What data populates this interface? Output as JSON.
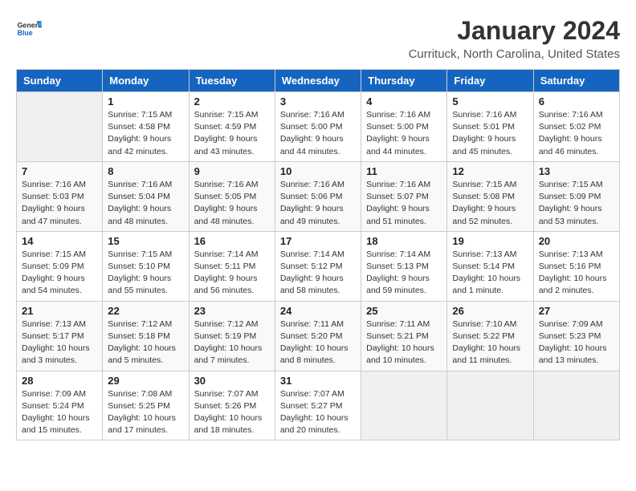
{
  "header": {
    "logo_general": "General",
    "logo_blue": "Blue",
    "main_title": "January 2024",
    "subtitle": "Currituck, North Carolina, United States"
  },
  "days_of_week": [
    "Sunday",
    "Monday",
    "Tuesday",
    "Wednesday",
    "Thursday",
    "Friday",
    "Saturday"
  ],
  "weeks": [
    [
      {
        "day": "",
        "info": ""
      },
      {
        "day": "1",
        "info": "Sunrise: 7:15 AM\nSunset: 4:58 PM\nDaylight: 9 hours\nand 42 minutes."
      },
      {
        "day": "2",
        "info": "Sunrise: 7:15 AM\nSunset: 4:59 PM\nDaylight: 9 hours\nand 43 minutes."
      },
      {
        "day": "3",
        "info": "Sunrise: 7:16 AM\nSunset: 5:00 PM\nDaylight: 9 hours\nand 44 minutes."
      },
      {
        "day": "4",
        "info": "Sunrise: 7:16 AM\nSunset: 5:00 PM\nDaylight: 9 hours\nand 44 minutes."
      },
      {
        "day": "5",
        "info": "Sunrise: 7:16 AM\nSunset: 5:01 PM\nDaylight: 9 hours\nand 45 minutes."
      },
      {
        "day": "6",
        "info": "Sunrise: 7:16 AM\nSunset: 5:02 PM\nDaylight: 9 hours\nand 46 minutes."
      }
    ],
    [
      {
        "day": "7",
        "info": "Sunrise: 7:16 AM\nSunset: 5:03 PM\nDaylight: 9 hours\nand 47 minutes."
      },
      {
        "day": "8",
        "info": "Sunrise: 7:16 AM\nSunset: 5:04 PM\nDaylight: 9 hours\nand 48 minutes."
      },
      {
        "day": "9",
        "info": "Sunrise: 7:16 AM\nSunset: 5:05 PM\nDaylight: 9 hours\nand 48 minutes."
      },
      {
        "day": "10",
        "info": "Sunrise: 7:16 AM\nSunset: 5:06 PM\nDaylight: 9 hours\nand 49 minutes."
      },
      {
        "day": "11",
        "info": "Sunrise: 7:16 AM\nSunset: 5:07 PM\nDaylight: 9 hours\nand 51 minutes."
      },
      {
        "day": "12",
        "info": "Sunrise: 7:15 AM\nSunset: 5:08 PM\nDaylight: 9 hours\nand 52 minutes."
      },
      {
        "day": "13",
        "info": "Sunrise: 7:15 AM\nSunset: 5:09 PM\nDaylight: 9 hours\nand 53 minutes."
      }
    ],
    [
      {
        "day": "14",
        "info": "Sunrise: 7:15 AM\nSunset: 5:09 PM\nDaylight: 9 hours\nand 54 minutes."
      },
      {
        "day": "15",
        "info": "Sunrise: 7:15 AM\nSunset: 5:10 PM\nDaylight: 9 hours\nand 55 minutes."
      },
      {
        "day": "16",
        "info": "Sunrise: 7:14 AM\nSunset: 5:11 PM\nDaylight: 9 hours\nand 56 minutes."
      },
      {
        "day": "17",
        "info": "Sunrise: 7:14 AM\nSunset: 5:12 PM\nDaylight: 9 hours\nand 58 minutes."
      },
      {
        "day": "18",
        "info": "Sunrise: 7:14 AM\nSunset: 5:13 PM\nDaylight: 9 hours\nand 59 minutes."
      },
      {
        "day": "19",
        "info": "Sunrise: 7:13 AM\nSunset: 5:14 PM\nDaylight: 10 hours\nand 1 minute."
      },
      {
        "day": "20",
        "info": "Sunrise: 7:13 AM\nSunset: 5:16 PM\nDaylight: 10 hours\nand 2 minutes."
      }
    ],
    [
      {
        "day": "21",
        "info": "Sunrise: 7:13 AM\nSunset: 5:17 PM\nDaylight: 10 hours\nand 3 minutes."
      },
      {
        "day": "22",
        "info": "Sunrise: 7:12 AM\nSunset: 5:18 PM\nDaylight: 10 hours\nand 5 minutes."
      },
      {
        "day": "23",
        "info": "Sunrise: 7:12 AM\nSunset: 5:19 PM\nDaylight: 10 hours\nand 7 minutes."
      },
      {
        "day": "24",
        "info": "Sunrise: 7:11 AM\nSunset: 5:20 PM\nDaylight: 10 hours\nand 8 minutes."
      },
      {
        "day": "25",
        "info": "Sunrise: 7:11 AM\nSunset: 5:21 PM\nDaylight: 10 hours\nand 10 minutes."
      },
      {
        "day": "26",
        "info": "Sunrise: 7:10 AM\nSunset: 5:22 PM\nDaylight: 10 hours\nand 11 minutes."
      },
      {
        "day": "27",
        "info": "Sunrise: 7:09 AM\nSunset: 5:23 PM\nDaylight: 10 hours\nand 13 minutes."
      }
    ],
    [
      {
        "day": "28",
        "info": "Sunrise: 7:09 AM\nSunset: 5:24 PM\nDaylight: 10 hours\nand 15 minutes."
      },
      {
        "day": "29",
        "info": "Sunrise: 7:08 AM\nSunset: 5:25 PM\nDaylight: 10 hours\nand 17 minutes."
      },
      {
        "day": "30",
        "info": "Sunrise: 7:07 AM\nSunset: 5:26 PM\nDaylight: 10 hours\nand 18 minutes."
      },
      {
        "day": "31",
        "info": "Sunrise: 7:07 AM\nSunset: 5:27 PM\nDaylight: 10 hours\nand 20 minutes."
      },
      {
        "day": "",
        "info": ""
      },
      {
        "day": "",
        "info": ""
      },
      {
        "day": "",
        "info": ""
      }
    ]
  ]
}
